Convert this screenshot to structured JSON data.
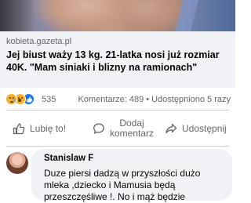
{
  "post": {
    "link_domain": "kobieta.gazeta.pl",
    "headline": "Jej biust waży 13 kg. 21-latka nosi już rozmiar 40K. \"Mam siniaki i blizny na ramionach\""
  },
  "stats": {
    "reaction_icons": [
      "sad-reaction-icon",
      "wow-reaction-icon",
      "like-reaction-icon"
    ],
    "reaction_count": "535",
    "comments": "Komentarze: 489",
    "separator": "•",
    "shares": "Udostępniono 5 razy"
  },
  "actions": {
    "like_label": "Lubię to!",
    "comment_label_line1": "Dodaj",
    "comment_label_line2": "komentarz",
    "share_label": "Udostępnij"
  },
  "comment": {
    "author": "Stanislaw F",
    "text": "Duze piersi dadzą w przyszłości dużo mleka ,dziecko i Mamusia będą przeszczęśliwe !. No i mąż będzie"
  },
  "colors": {
    "brand_blue": "#1877f2",
    "muted_text": "#65676b",
    "bubble_bg": "#f0f2f5"
  }
}
